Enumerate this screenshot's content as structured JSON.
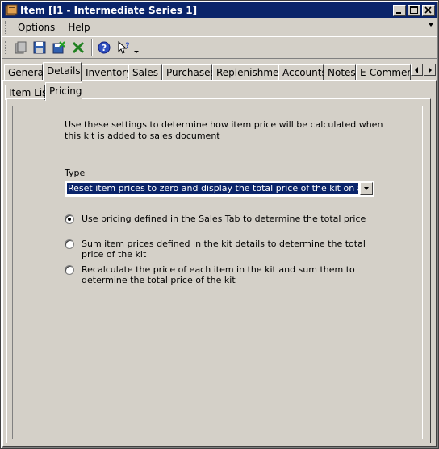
{
  "window": {
    "title": "Item [I1 - Intermediate Series 1]"
  },
  "menu": {
    "items": [
      "Options",
      "Help"
    ]
  },
  "toolbar": {
    "icons": [
      "new-icon",
      "save-icon",
      "save-close-icon",
      "delete-icon",
      "help-icon",
      "whats-this-icon"
    ]
  },
  "tabs": {
    "items": [
      "General",
      "Details",
      "Inventory",
      "Sales",
      "Purchases",
      "Replenishment",
      "Accounts",
      "Notes",
      "E-Commerce"
    ],
    "active": "Details"
  },
  "subtabs": {
    "items": [
      "Item List",
      "Pricing"
    ],
    "active": "Pricing"
  },
  "pricing": {
    "description": "Use these settings to determine how item price will be calculated when this kit is added to sales document",
    "type_label": "Type",
    "type_value": "Reset item prices to zero and display the total price of the kit on a total line",
    "options": [
      {
        "label": "Use pricing defined in the Sales Tab to determine the total price",
        "checked": true
      },
      {
        "label": "Sum item prices defined in the kit details to determine the total price of the kit",
        "checked": false
      },
      {
        "label": "Recalculate the price of each item in the kit and sum them to determine the total price of the kit",
        "checked": false
      }
    ]
  },
  "colors": {
    "titlebar": "#0a246a",
    "face": "#d4d0c8",
    "selection": "#0a246a"
  }
}
